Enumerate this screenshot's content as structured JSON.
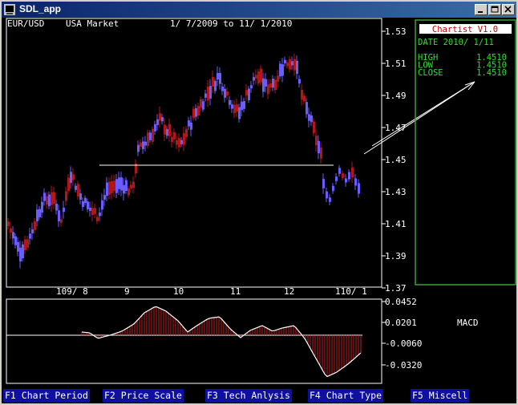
{
  "window": {
    "title": "SDL_app"
  },
  "header": {
    "pair": "EUR/USD",
    "market": "USA Market",
    "date_range": "1/ 7/2009 to 11/ 1/2010"
  },
  "info_panel": {
    "title": "Chartist V1.0",
    "date": "DATE 2010/ 1/11",
    "rows": [
      {
        "label": "HIGH",
        "value": "1.4510"
      },
      {
        "label": "LOW",
        "value": "1.4510"
      },
      {
        "label": "CLOSE",
        "value": "1.4510"
      }
    ]
  },
  "price_axis": [
    "1.53",
    "1.51",
    "1.49",
    "1.47",
    "1.45",
    "1.43",
    "1.41",
    "1.39",
    "1.37"
  ],
  "x_labels": [
    "109/ 8",
    "9",
    "10",
    "11",
    "12",
    "110/ 1"
  ],
  "macd": {
    "label": "MACD",
    "axis": [
      "0.0452",
      "0.0201",
      "-0.0060",
      "-0.0320"
    ]
  },
  "support_level": 1.4465,
  "colors": {
    "up": "#b01818",
    "down": "#6a5cff",
    "panel_border": "#3aa03a",
    "info_text": "#33dd33",
    "title_red": "#c00000"
  },
  "function_keys": [
    {
      "key": "F1",
      "label": "Chart Period"
    },
    {
      "key": "F2",
      "label": "Price Scale"
    },
    {
      "key": "F3",
      "label": "Tech Anlysis"
    },
    {
      "key": "F4",
      "label": "Chart Type"
    },
    {
      "key": "F5",
      "label": "Miscell"
    }
  ]
}
